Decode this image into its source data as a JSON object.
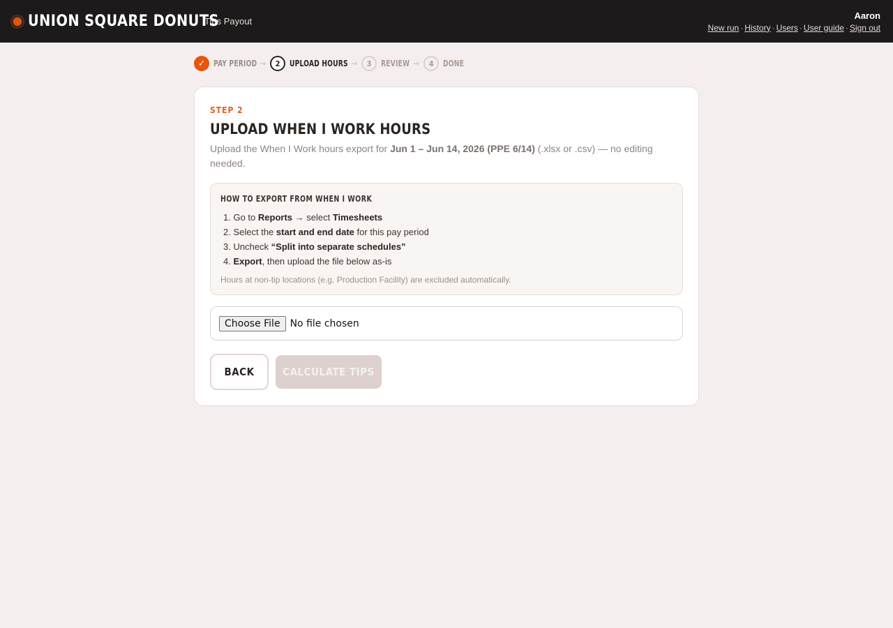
{
  "header": {
    "brand": "UNION SQUARE DONUTS",
    "subtitle": "Tips Payout",
    "user": "Aaron",
    "links": [
      "New run",
      "History",
      "Users",
      "User guide",
      "Sign out"
    ]
  },
  "stepper": {
    "steps": [
      {
        "number": "✓",
        "label": "PAY PERIOD",
        "state": "done"
      },
      {
        "number": "2",
        "label": "UPLOAD HOURS",
        "state": "current"
      },
      {
        "number": "3",
        "label": "REVIEW",
        "state": "future"
      },
      {
        "number": "4",
        "label": "DONE",
        "state": "future"
      }
    ],
    "arrow": "→"
  },
  "card": {
    "step_tag": "STEP 2",
    "title": "UPLOAD WHEN I WORK HOURS",
    "desc_prefix": "Upload the When I Work hours export for ",
    "desc_period": "Jun 1 – Jun 14, 2026 (PPE 6/14)",
    "desc_suffix": " (.xlsx or .csv) — no editing needed.",
    "howto": {
      "title": "HOW TO EXPORT FROM WHEN I WORK",
      "steps": [
        {
          "n": "1.",
          "a": "Go to ",
          "b1": "Reports",
          "c": " → select ",
          "b2": "Timesheets",
          "d": ""
        },
        {
          "n": "2.",
          "a": "Select the ",
          "b1": "start and end date",
          "c": " for this pay period",
          "b2": "",
          "d": ""
        },
        {
          "n": "3.",
          "a": "Uncheck ",
          "b1": "“Split into separate schedules”",
          "c": "",
          "b2": "",
          "d": ""
        },
        {
          "n": "4.",
          "a": "",
          "b1": "Export",
          "c": ", then upload the file below as-is",
          "b2": "",
          "d": ""
        }
      ],
      "note": "Hours at non-tip locations (e.g. Production Facility) are excluded automatically."
    },
    "file": {
      "button": "Choose File",
      "status": "No file chosen"
    },
    "back_label": "BACK",
    "calc_label": "CALCULATE TIPS"
  },
  "colors": {
    "accent": "#e8540c",
    "topbar": "#1c1a1a",
    "background": "#f4eeee",
    "disabled_button": "#dcd1ce"
  }
}
